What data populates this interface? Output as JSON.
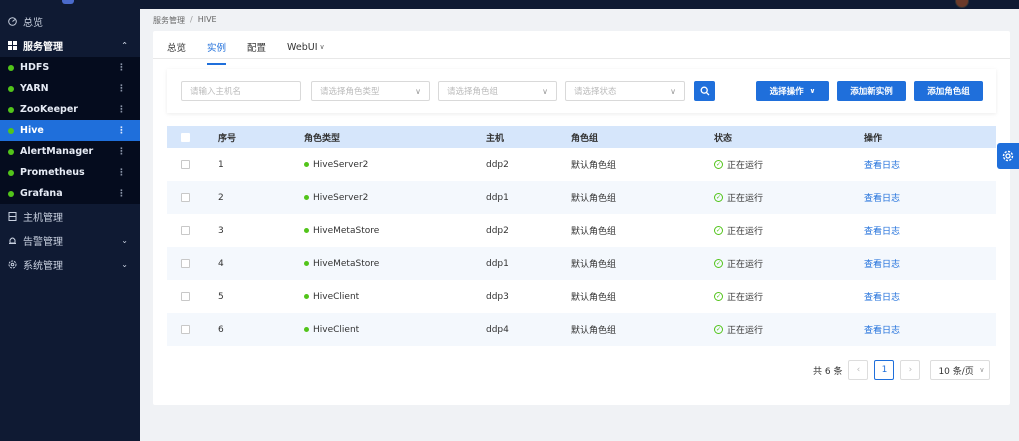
{
  "colors": {
    "accent": "#1f6fdb",
    "sidebar_bg": "#0f1a33",
    "running": "#52c41a",
    "header_row": "#d6e6fb"
  },
  "sidebar": {
    "items": [
      {
        "label": "总览",
        "icon": "dashboard-icon"
      },
      {
        "label": "服务管理",
        "icon": "grid-icon",
        "expanded": true
      },
      {
        "label": "主机管理",
        "icon": "server-icon"
      },
      {
        "label": "告警管理",
        "icon": "bell-icon"
      },
      {
        "label": "系统管理",
        "icon": "gear-icon"
      }
    ],
    "services": [
      {
        "label": "HDFS"
      },
      {
        "label": "YARN"
      },
      {
        "label": "ZooKeeper"
      },
      {
        "label": "Hive",
        "active": true
      },
      {
        "label": "AlertManager"
      },
      {
        "label": "Prometheus"
      },
      {
        "label": "Grafana"
      }
    ]
  },
  "breadcrumb": {
    "parent": "服务管理",
    "sep": "/",
    "current": "HIVE"
  },
  "tabs": [
    {
      "label": "总览"
    },
    {
      "label": "实例",
      "active": true
    },
    {
      "label": "配置"
    },
    {
      "label": "WebUI",
      "dropdown": true
    }
  ],
  "filters": {
    "host_placeholder": "请输入主机名",
    "role_type_placeholder": "请选择角色类型",
    "role_group_placeholder": "请选择角色组",
    "status_placeholder": "请选择状态"
  },
  "actions": {
    "select_op": "选择操作",
    "add_instance": "添加新实例",
    "add_role_group": "添加角色组"
  },
  "table": {
    "headers": {
      "no": "序号",
      "role_type": "角色类型",
      "host": "主机",
      "role_group": "角色组",
      "status": "状态",
      "op": "操作"
    },
    "rows": [
      {
        "no": "1",
        "role_type": "HiveServer2",
        "host": "ddp2",
        "role_group": "默认角色组",
        "status": "正在运行",
        "op": "查看日志"
      },
      {
        "no": "2",
        "role_type": "HiveServer2",
        "host": "ddp1",
        "role_group": "默认角色组",
        "status": "正在运行",
        "op": "查看日志"
      },
      {
        "no": "3",
        "role_type": "HiveMetaStore",
        "host": "ddp2",
        "role_group": "默认角色组",
        "status": "正在运行",
        "op": "查看日志"
      },
      {
        "no": "4",
        "role_type": "HiveMetaStore",
        "host": "ddp1",
        "role_group": "默认角色组",
        "status": "正在运行",
        "op": "查看日志"
      },
      {
        "no": "5",
        "role_type": "HiveClient",
        "host": "ddp3",
        "role_group": "默认角色组",
        "status": "正在运行",
        "op": "查看日志"
      },
      {
        "no": "6",
        "role_type": "HiveClient",
        "host": "ddp4",
        "role_group": "默认角色组",
        "status": "正在运行",
        "op": "查看日志"
      }
    ]
  },
  "pagination": {
    "total": "共 6 条",
    "current_page": "1",
    "page_size": "10 条/页"
  }
}
